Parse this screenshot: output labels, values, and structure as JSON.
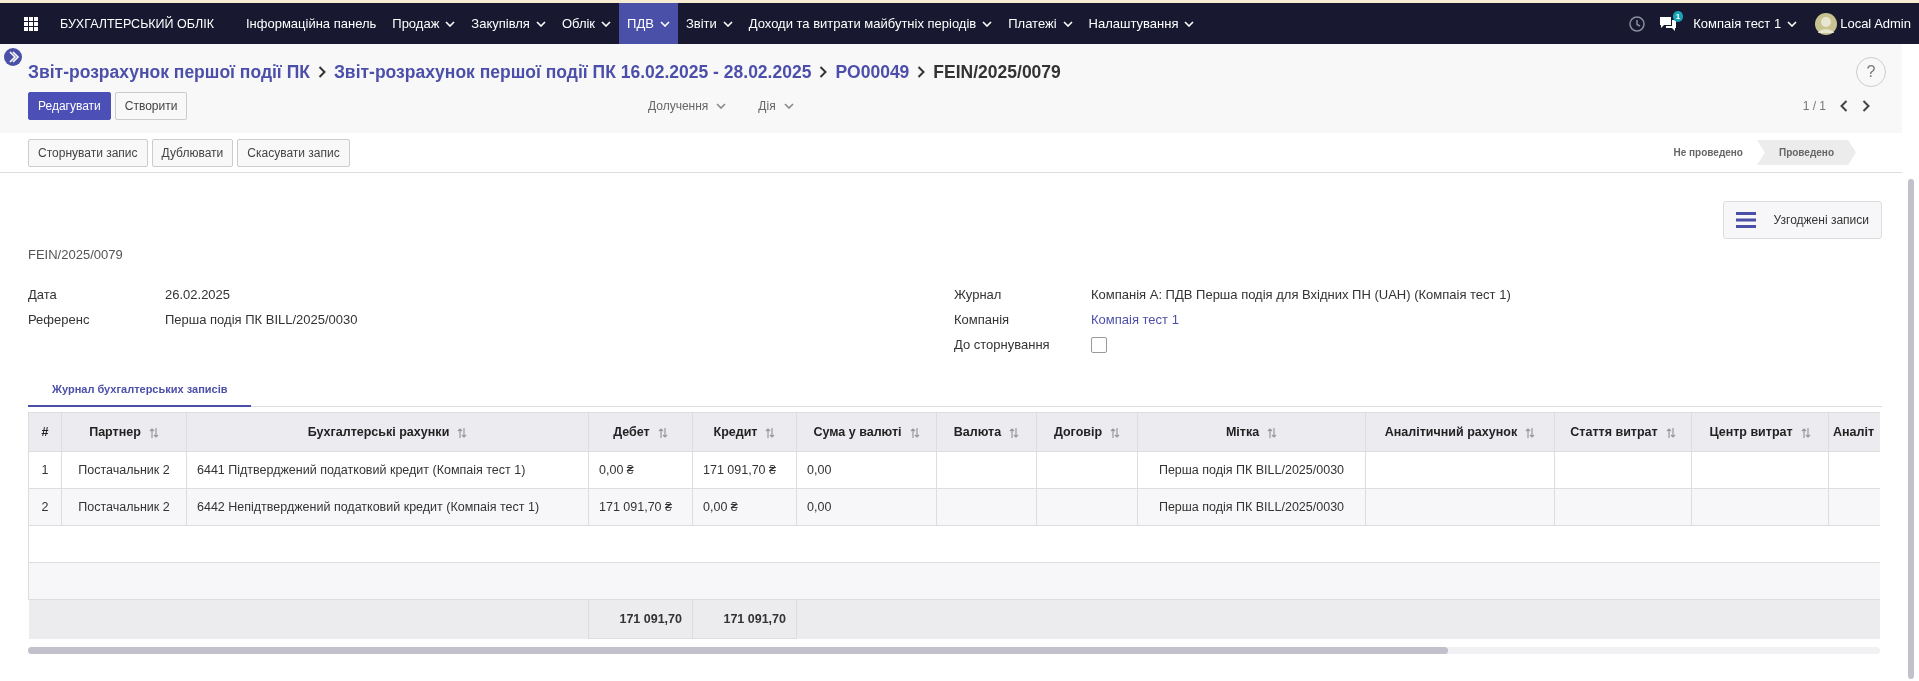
{
  "app_title": "БУХГАЛТЕРСЬКИЙ ОБЛІК",
  "menu": [
    {
      "label": "Інформаційна панель",
      "dropdown": false,
      "selected": false
    },
    {
      "label": "Продаж",
      "dropdown": true,
      "selected": false
    },
    {
      "label": "Закупівля",
      "dropdown": true,
      "selected": false
    },
    {
      "label": "Облік",
      "dropdown": true,
      "selected": false
    },
    {
      "label": "ПДВ",
      "dropdown": true,
      "selected": true
    },
    {
      "label": "Звіти",
      "dropdown": true,
      "selected": false
    },
    {
      "label": "Доходи та витрати майбутніх періодів",
      "dropdown": true,
      "selected": false
    },
    {
      "label": "Платежі",
      "dropdown": true,
      "selected": false
    },
    {
      "label": "Налаштування",
      "dropdown": true,
      "selected": false
    }
  ],
  "systray": {
    "chat_count": "1",
    "company": "Компаія тест 1",
    "user": "Local Admin"
  },
  "breadcrumbs": [
    {
      "label": "Звіт-розрахунок першої події ПК",
      "kind": "link"
    },
    {
      "label": "Звіт-розрахунок першої події ПК 16.02.2025 - 28.02.2025",
      "kind": "link"
    },
    {
      "label": "PO00049",
      "kind": "link"
    },
    {
      "label": "FEIN/2025/0079",
      "kind": "current"
    }
  ],
  "help": "?",
  "buttons": [
    {
      "label": "Редагувати",
      "kind": "primary"
    },
    {
      "label": "Створити",
      "kind": "secondary"
    }
  ],
  "dropdowns": [
    "Долучення",
    "Дія"
  ],
  "pager": "1 / 1",
  "actions": [
    "Сторнувати запис",
    "Дублювати",
    "Скасувати запис"
  ],
  "statuses": [
    {
      "label": "Не проведено",
      "selected": false
    },
    {
      "label": "Проведено",
      "selected": true
    }
  ],
  "smart_button": "Узгоджені записи",
  "record_name": "FEIN/2025/0079",
  "fields_left": [
    {
      "label": "Дата",
      "kind": "text",
      "value": "26.02.2025"
    },
    {
      "label": "Референс",
      "kind": "text",
      "value": "Перша подія ПК BILL/2025/0030"
    }
  ],
  "fields_right": [
    {
      "label": "Журнал",
      "kind": "text",
      "value": "Компанія А: ПДВ Перша подія для Вхідних ПН (UAH) (Компаія тест 1)"
    },
    {
      "label": "Компанія",
      "kind": "link",
      "value": "Компаія тест 1"
    },
    {
      "label": "До сторнування",
      "kind": "checkbox",
      "checked": false
    }
  ],
  "tabs": [
    {
      "label": "Журнал бухгалтерських записів",
      "selected": true
    }
  ],
  "table": {
    "columns": [
      {
        "label": "#",
        "sortable": false
      },
      {
        "label": "Партнер",
        "sortable": true
      },
      {
        "label": "Бухгалтерські рахунки",
        "sortable": true
      },
      {
        "label": "Дебет",
        "sortable": true
      },
      {
        "label": "Кредит",
        "sortable": true
      },
      {
        "label": "Сума у валюті",
        "sortable": true
      },
      {
        "label": "Валюта",
        "sortable": true
      },
      {
        "label": "Договір",
        "sortable": true
      },
      {
        "label": "Мітка",
        "sortable": true
      },
      {
        "label": "Аналітичний рахунок",
        "sortable": true
      },
      {
        "label": "Стаття витрат",
        "sortable": true
      },
      {
        "label": "Центр витрат",
        "sortable": true
      },
      {
        "label": "Аналіт",
        "sortable": false
      }
    ],
    "rows": [
      {
        "number": "1",
        "partner": "Постачальник 2",
        "account": "6441 Підтверджений податковий кредит (Компаія тест 1)",
        "debit": "0,00 ₴",
        "credit": "171 091,70 ₴",
        "amount_currency": "0,00",
        "label": "Перша подія ПК BILL/2025/0030"
      },
      {
        "number": "2",
        "partner": "Постачальник 2",
        "account": "6442 Непідтверджений податковий кредит (Компаія тест 1)",
        "debit": "171 091,70 ₴",
        "credit": "0,00 ₴",
        "amount_currency": "0,00",
        "label": "Перша подія ПК BILL/2025/0030"
      }
    ],
    "totals": {
      "debit": "171 091,70",
      "credit": "171 091,70"
    }
  }
}
